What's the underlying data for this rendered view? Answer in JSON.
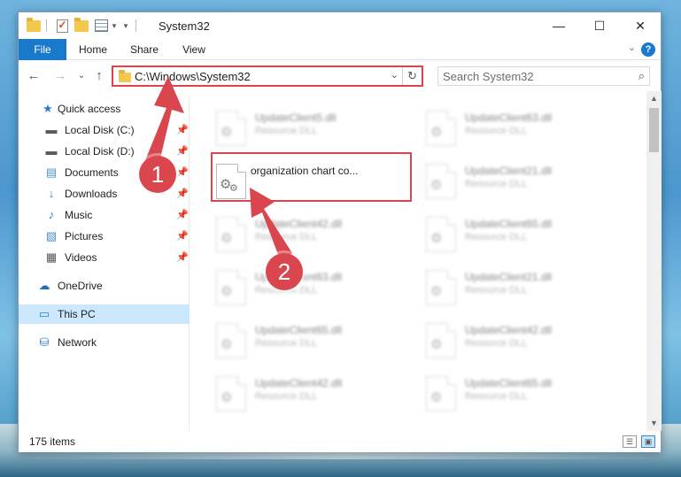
{
  "window": {
    "title": "System32",
    "controls": {
      "minimize": "—",
      "maximize": "☐",
      "close": "✕"
    }
  },
  "ribbon": {
    "tabs": [
      "File",
      "Home",
      "Share",
      "View"
    ],
    "help": "?",
    "collapse": "⌄"
  },
  "nav": {
    "back": "←",
    "forward": "→",
    "recent": "⌄",
    "up": "↑",
    "address": "C:\\Windows\\System32",
    "address_dropdown": "⌄",
    "refresh": "↻",
    "search_placeholder": "Search System32",
    "search_icon": "⌕"
  },
  "sidebar": {
    "items": [
      {
        "label": "Quick access",
        "icon": "star-icon",
        "glyph": "★",
        "color": "#2b7cd3",
        "pinned": false
      },
      {
        "label": "Local Disk (C:)",
        "icon": "drive-icon",
        "glyph": "▬",
        "color": "#5a5a5a",
        "pinned": true
      },
      {
        "label": "Local Disk (D:)",
        "icon": "drive-icon",
        "glyph": "▬",
        "color": "#5a5a5a",
        "pinned": true
      },
      {
        "label": "Documents",
        "icon": "documents-icon",
        "glyph": "▤",
        "color": "#4d8fd1",
        "pinned": true
      },
      {
        "label": "Downloads",
        "icon": "download-icon",
        "glyph": "↓",
        "color": "#2b7cd3",
        "pinned": true
      },
      {
        "label": "Music",
        "icon": "music-icon",
        "glyph": "♪",
        "color": "#2b7cd3",
        "pinned": true
      },
      {
        "label": "Pictures",
        "icon": "pictures-icon",
        "glyph": "▧",
        "color": "#4d8fd1",
        "pinned": true
      },
      {
        "label": "Videos",
        "icon": "videos-icon",
        "glyph": "▦",
        "color": "#555555",
        "pinned": true
      },
      {
        "label": "OneDrive",
        "icon": "cloud-icon",
        "glyph": "☁",
        "color": "#1e6fc4",
        "pinned": false
      },
      {
        "label": "This PC",
        "icon": "computer-icon",
        "glyph": "▭",
        "color": "#2b7cd3",
        "pinned": false,
        "selected": true
      },
      {
        "label": "Network",
        "icon": "network-icon",
        "glyph": "⛁",
        "color": "#2b7cd3",
        "pinned": false
      }
    ],
    "pin_glyph": "📌"
  },
  "files": {
    "left_column": [
      {
        "name": "UpdateClient5.dll",
        "type": "Resource DLL"
      },
      {
        "name": "organization chart co...",
        "type": ""
      },
      {
        "name": "UpdateClient42.dll",
        "type": "Resource DLL"
      },
      {
        "name": "UpdateClient63.dll",
        "type": "Resource DLL"
      },
      {
        "name": "UpdateClient65.dll",
        "type": "Resource DLL"
      },
      {
        "name": "UpdateClient42.dll",
        "type": "Resource DLL"
      }
    ],
    "right_column": [
      {
        "name": "UpdateClient63.dll",
        "type": "Resource DLL"
      },
      {
        "name": "UpdateClient21.dll",
        "type": "Resource DLL"
      },
      {
        "name": "UpdateClient65.dll",
        "type": "Resource DLL"
      },
      {
        "name": "UpdateClient21.dll",
        "type": "Resource DLL"
      },
      {
        "name": "UpdateClient42.dll",
        "type": "Resource DLL"
      },
      {
        "name": "UpdateClient65.dll",
        "type": "Resource DLL"
      }
    ],
    "gear_glyph": "⚙"
  },
  "status": {
    "item_count": "175 items"
  },
  "callouts": [
    {
      "number": "1"
    },
    {
      "number": "2"
    }
  ],
  "colors": {
    "accent": "#1979ca",
    "highlight": "#d9464e",
    "selection": "#cce8ff"
  }
}
